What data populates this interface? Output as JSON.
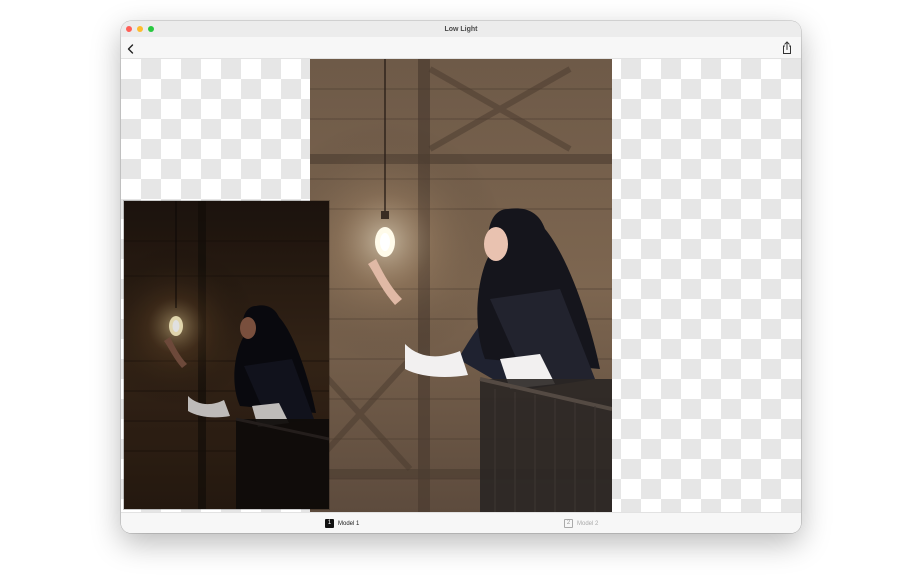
{
  "window": {
    "title": "Low Light"
  },
  "toolbar": {
    "back_icon": "chevron-left-icon",
    "share_icon": "share-icon"
  },
  "tabs": [
    {
      "number": "1",
      "label": "Model 1",
      "active": true
    },
    {
      "number": "2",
      "label": "Model 2",
      "active": false
    }
  ],
  "colors": {
    "close": "#ff5f57",
    "minimize": "#febc2e",
    "zoom": "#28c840"
  }
}
